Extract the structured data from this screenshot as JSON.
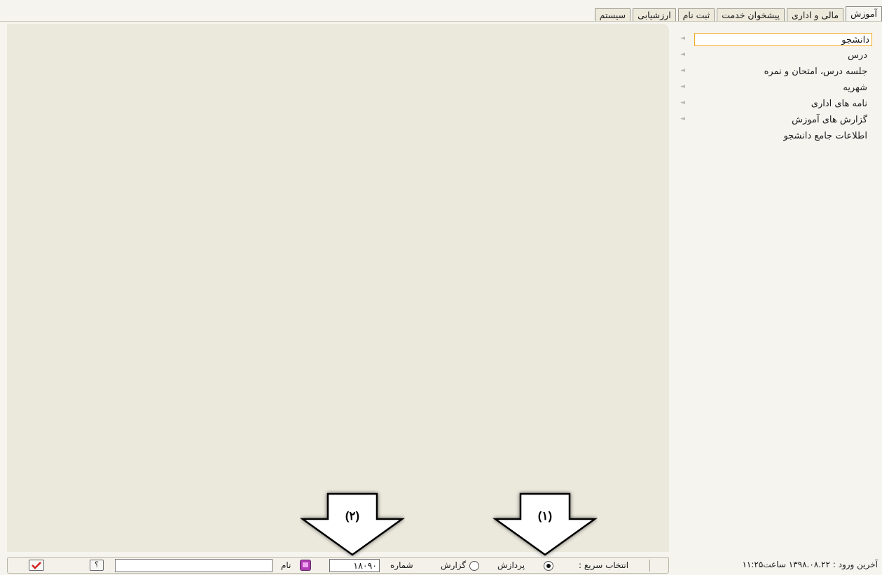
{
  "tabs": [
    {
      "label": "آموزش",
      "active": true
    },
    {
      "label": "مالی و اداری",
      "active": false
    },
    {
      "label": "پیشخوان خدمت",
      "active": false
    },
    {
      "label": "ثبت نام",
      "active": false
    },
    {
      "label": "ارزشیابی",
      "active": false
    },
    {
      "label": "سیستم",
      "active": false
    }
  ],
  "menu": [
    {
      "label": "دانشجو",
      "selected": true,
      "has_submenu": true
    },
    {
      "label": "درس",
      "selected": false,
      "has_submenu": true
    },
    {
      "label": "جلسه درس، امتحان و نمره",
      "selected": false,
      "has_submenu": true
    },
    {
      "label": "شهریه",
      "selected": false,
      "has_submenu": true
    },
    {
      "label": "نامه های اداری",
      "selected": false,
      "has_submenu": true
    },
    {
      "label": "گزارش های آموزش",
      "selected": false,
      "has_submenu": true
    },
    {
      "label": "اطلاعات جامع دانشجو",
      "selected": false,
      "has_submenu": false
    }
  ],
  "arrows": [
    {
      "label": "(۱)"
    },
    {
      "label": "(۲)"
    }
  ],
  "statusbar": {
    "last_login": "آخرین ورود : ۱۳۹۸.۰۸.۲۲ ساعت۱۱:۲۵",
    "quick_select_label": "انتخاب سریع :",
    "process_label": "پردازش",
    "report_label": "گزارش",
    "process_selected": true,
    "number_label": "شماره",
    "number_value": "۱۸۰۹۰",
    "name_label": "نام",
    "name_value": "",
    "help_symbol": "؟"
  },
  "colors": {
    "background": "#f5f4ef",
    "panel": "#ebe8dc",
    "selection_border": "#f4a922",
    "confirm_check": "#d11f1f",
    "book_icon": "#b33db6"
  }
}
